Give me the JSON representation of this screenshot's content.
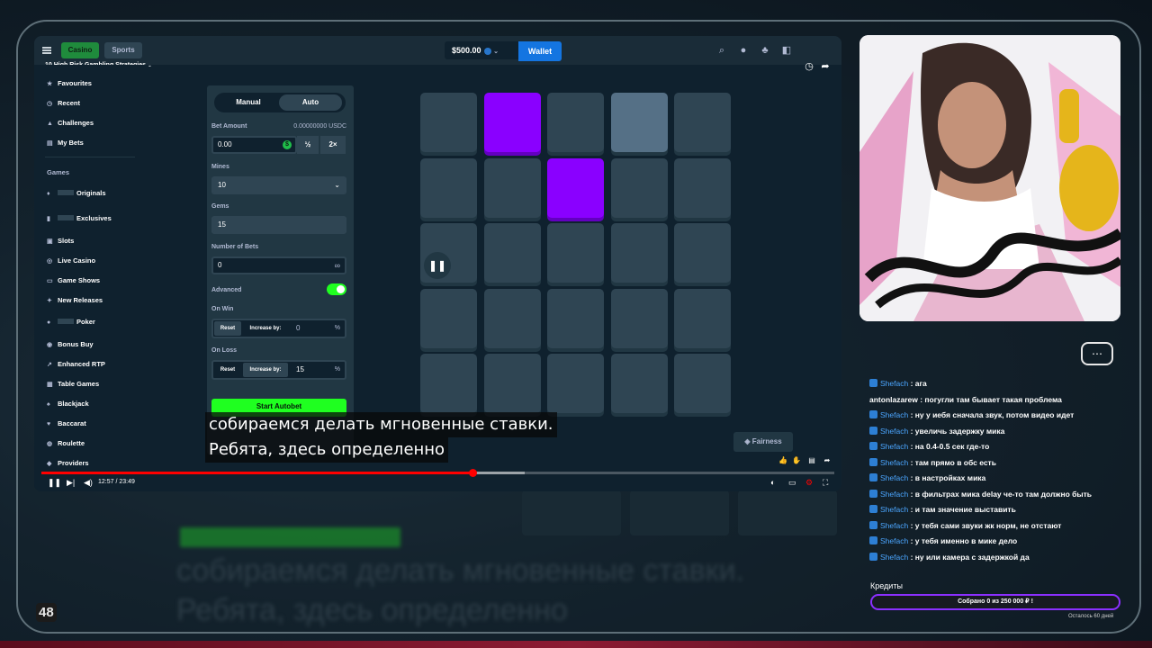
{
  "overlay": {
    "page_number": "48",
    "background_subtitle_1": "собираемся делать мгновенные ставки.",
    "background_subtitle_2": "Ребята, здесь определенно"
  },
  "player": {
    "video_title": "10 High Risk Gambling Strategies...",
    "subtitle_line1": "собираемся делать мгновенные ставки.",
    "subtitle_line2": "Ребята, здесь определенно",
    "time": "12:57 / 23:49",
    "progress": 0.544,
    "buffered": 0.61
  },
  "site": {
    "tabs": [
      {
        "label": "Casino"
      },
      {
        "label": "Sports"
      }
    ],
    "balance": "$500.00",
    "wallet_label": "Wallet",
    "nav": {
      "favourites": "Favourites",
      "recent": "Recent",
      "challenges": "Challenges",
      "my_bets": "My Bets",
      "games_section": "Games",
      "originals": "Originals",
      "exclusives": "Exclusives",
      "slots": "Slots",
      "live_casino": "Live Casino",
      "game_shows": "Game Shows",
      "new_releases": "New Releases",
      "poker": "Poker",
      "bonus_buy": "Bonus Buy",
      "enhanced_rtp": "Enhanced RTP",
      "table_games": "Table Games",
      "blackjack": "Blackjack",
      "baccarat": "Baccarat",
      "roulette": "Roulette",
      "providers": "Providers"
    }
  },
  "bet_panel": {
    "manual_label": "Manual",
    "auto_label": "Auto",
    "bet_amount_label": "Bet Amount",
    "bet_amount_usdc": "0.00000000 USDC",
    "bet_amount_value": "0.00",
    "half_label": "½",
    "double_label": "2×",
    "mines_label": "Mines",
    "mines_value": "10",
    "gems_label": "Gems",
    "gems_value": "15",
    "number_of_bets_label": "Number of Bets",
    "number_of_bets_value": "0",
    "infinity": "∞",
    "advanced_label": "Advanced",
    "advanced_on": true,
    "on_win_label": "On Win",
    "on_win_reset": "Reset",
    "on_win_increase": "Increase by:",
    "on_win_value": "0",
    "on_loss_label": "On Loss",
    "on_loss_reset": "Reset",
    "on_loss_increase": "Increase by:",
    "on_loss_value": "15",
    "percent": "%",
    "start_autobet": "Start Autobet"
  },
  "board": {
    "rows": 5,
    "cols": 5,
    "gems": [
      [
        0,
        1
      ],
      [
        1,
        2
      ]
    ],
    "hover": [
      0,
      3
    ],
    "fairness_label": "Fairness"
  },
  "chat": {
    "messages": [
      {
        "user": "Shefach",
        "text": "ага",
        "badge": true
      },
      {
        "user": "antonlazarew",
        "text": "погугли там бывает такая проблема",
        "badge": false
      },
      {
        "user": "Shefach",
        "text": "ну у иебя сначала звук, потом видео идет",
        "badge": true
      },
      {
        "user": "Shefach",
        "text": "увеличь задержку мика",
        "badge": true
      },
      {
        "user": "Shefach",
        "text": "на 0.4-0.5 сек где-то",
        "badge": true
      },
      {
        "user": "Shefach",
        "text": "там прямо в обс есть",
        "badge": true
      },
      {
        "user": "Shefach",
        "text": "в настройках мика",
        "badge": true
      },
      {
        "user": "Shefach",
        "text": "в фильтрах мика delay че-то там должно быть",
        "badge": true
      },
      {
        "user": "Shefach",
        "text": "и там значение выставить",
        "badge": true
      },
      {
        "user": "Shefach",
        "text": "у тебя сами звуки жк норм, не отстают",
        "badge": true
      },
      {
        "user": "Shefach",
        "text": "у тебя именно в мике дело",
        "badge": true
      },
      {
        "user": "Shefach",
        "text": "ну или камера с задержкой да",
        "badge": true
      }
    ],
    "credits_label": "Кредиты",
    "credits_bar": "Собрано 0  из 250 000 ₽ !",
    "credits_left": "Осталось 60 дней"
  },
  "colors": {
    "gem": "#8a00ff",
    "tile": "#2f4553",
    "accent_green": "#1fff20",
    "wallet_blue": "#1475e1",
    "progress_red": "#ff0000"
  }
}
